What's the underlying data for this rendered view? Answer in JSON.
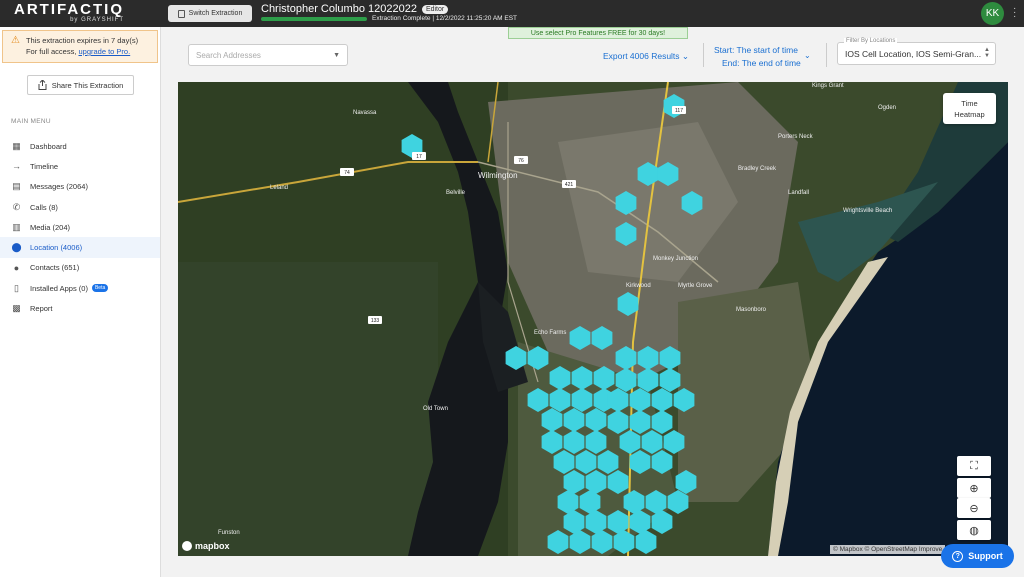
{
  "header": {
    "logo_main": "ARTIFACTIQ",
    "logo_by": "by GRAYSHIFT",
    "switch_label": "Switch Extraction",
    "extraction_title": "Christopher Columbo 12022022",
    "role_badge": "Editor",
    "progress_fraction": 1.0,
    "status_text": "Extraction Complete | 12/2/2022 11:25:20 AM EST",
    "avatar_initials": "KK"
  },
  "banner": {
    "expire_text": "This extraction expires in 7 day(s)",
    "access_text": "For full access, ",
    "upgrade_link": "upgrade to Pro.",
    "promo_text": "Use select Pro Features FREE for 30 days!"
  },
  "sidebar": {
    "share_label": "Share This Extraction",
    "menu_title": "MAIN MENU",
    "items": [
      {
        "label": "Dashboard",
        "icon": "dashboard-icon"
      },
      {
        "label": "Timeline",
        "icon": "timeline-arrow-icon"
      },
      {
        "label": "Messages (2064)",
        "icon": "messages-icon"
      },
      {
        "label": "Calls (8)",
        "icon": "phone-icon"
      },
      {
        "label": "Media (204)",
        "icon": "media-icon"
      },
      {
        "label": "Location (4006)",
        "icon": "location-pin-icon",
        "active": true
      },
      {
        "label": "Contacts (651)",
        "icon": "person-icon"
      },
      {
        "label": "Installed Apps (0)",
        "icon": "phone-device-icon",
        "badge": "Beta"
      },
      {
        "label": "Report",
        "icon": "report-icon"
      }
    ]
  },
  "toolbar": {
    "search_placeholder": "Search Addresses",
    "export_label": "Export 4006 Results",
    "start_label": "Start: The start of time",
    "end_label": "End: The end of time",
    "filter_label": "Filter By Locations",
    "filter_value": "IOS Cell Location, IOS Semi-Gran..."
  },
  "map": {
    "time_heatmap_label_1": "Time",
    "time_heatmap_label_2": "Heatmap",
    "brand": "mapbox",
    "attribution": "© Mapbox © OpenStreetMap  Improve",
    "hex_color": "#3fd3e0",
    "place_labels": [
      "Navassa",
      "Leland",
      "Belville",
      "Wilmington",
      "Wrightsville Beach",
      "Old Town",
      "Funston",
      "Echo Farms",
      "Masonboro",
      "Monkey Junction",
      "Bradley Creek",
      "Landfall",
      "Kings Grant",
      "Ogden",
      "Porters Neck",
      "Kirkwood",
      "Myrtle Grove"
    ],
    "road_labels": [
      "17",
      "74",
      "421",
      "133",
      "76",
      "117"
    ]
  },
  "support_label": "Support"
}
